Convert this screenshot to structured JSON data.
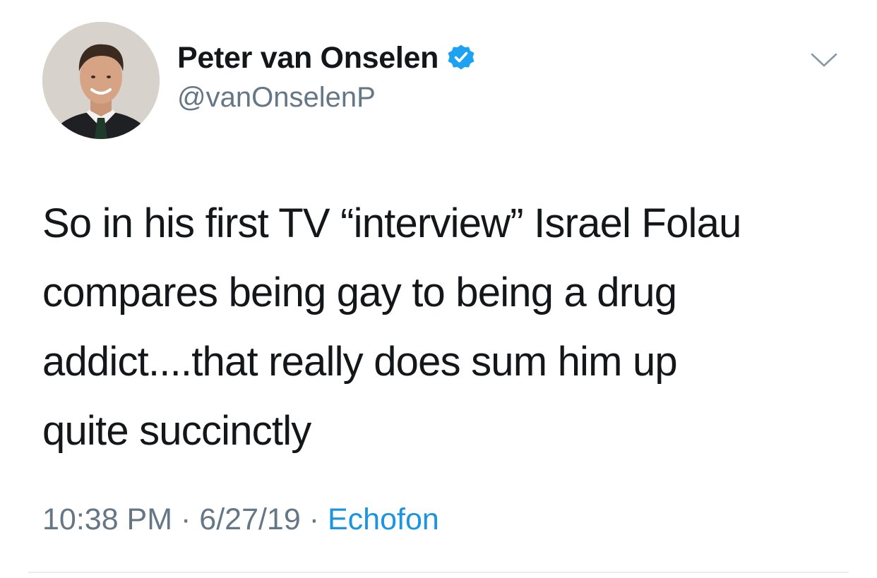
{
  "author": {
    "display_name": "Peter van Onselen",
    "handle": "@vanOnselenP",
    "verified": true,
    "verified_icon": "verified-badge-icon",
    "verified_color": "#1da1f2"
  },
  "tweet": {
    "text_lines": [
      "So in his first TV “interview” Israel Folau",
      "compares being gay to being a drug",
      "addict....that really does sum him up",
      "quite succinctly"
    ]
  },
  "meta": {
    "time": "10:38 PM",
    "separator": "·",
    "date": "6/27/19",
    "source": "Echofon",
    "source_color": "#1b95e0"
  },
  "icons": {
    "menu": "chevron-down-icon"
  }
}
